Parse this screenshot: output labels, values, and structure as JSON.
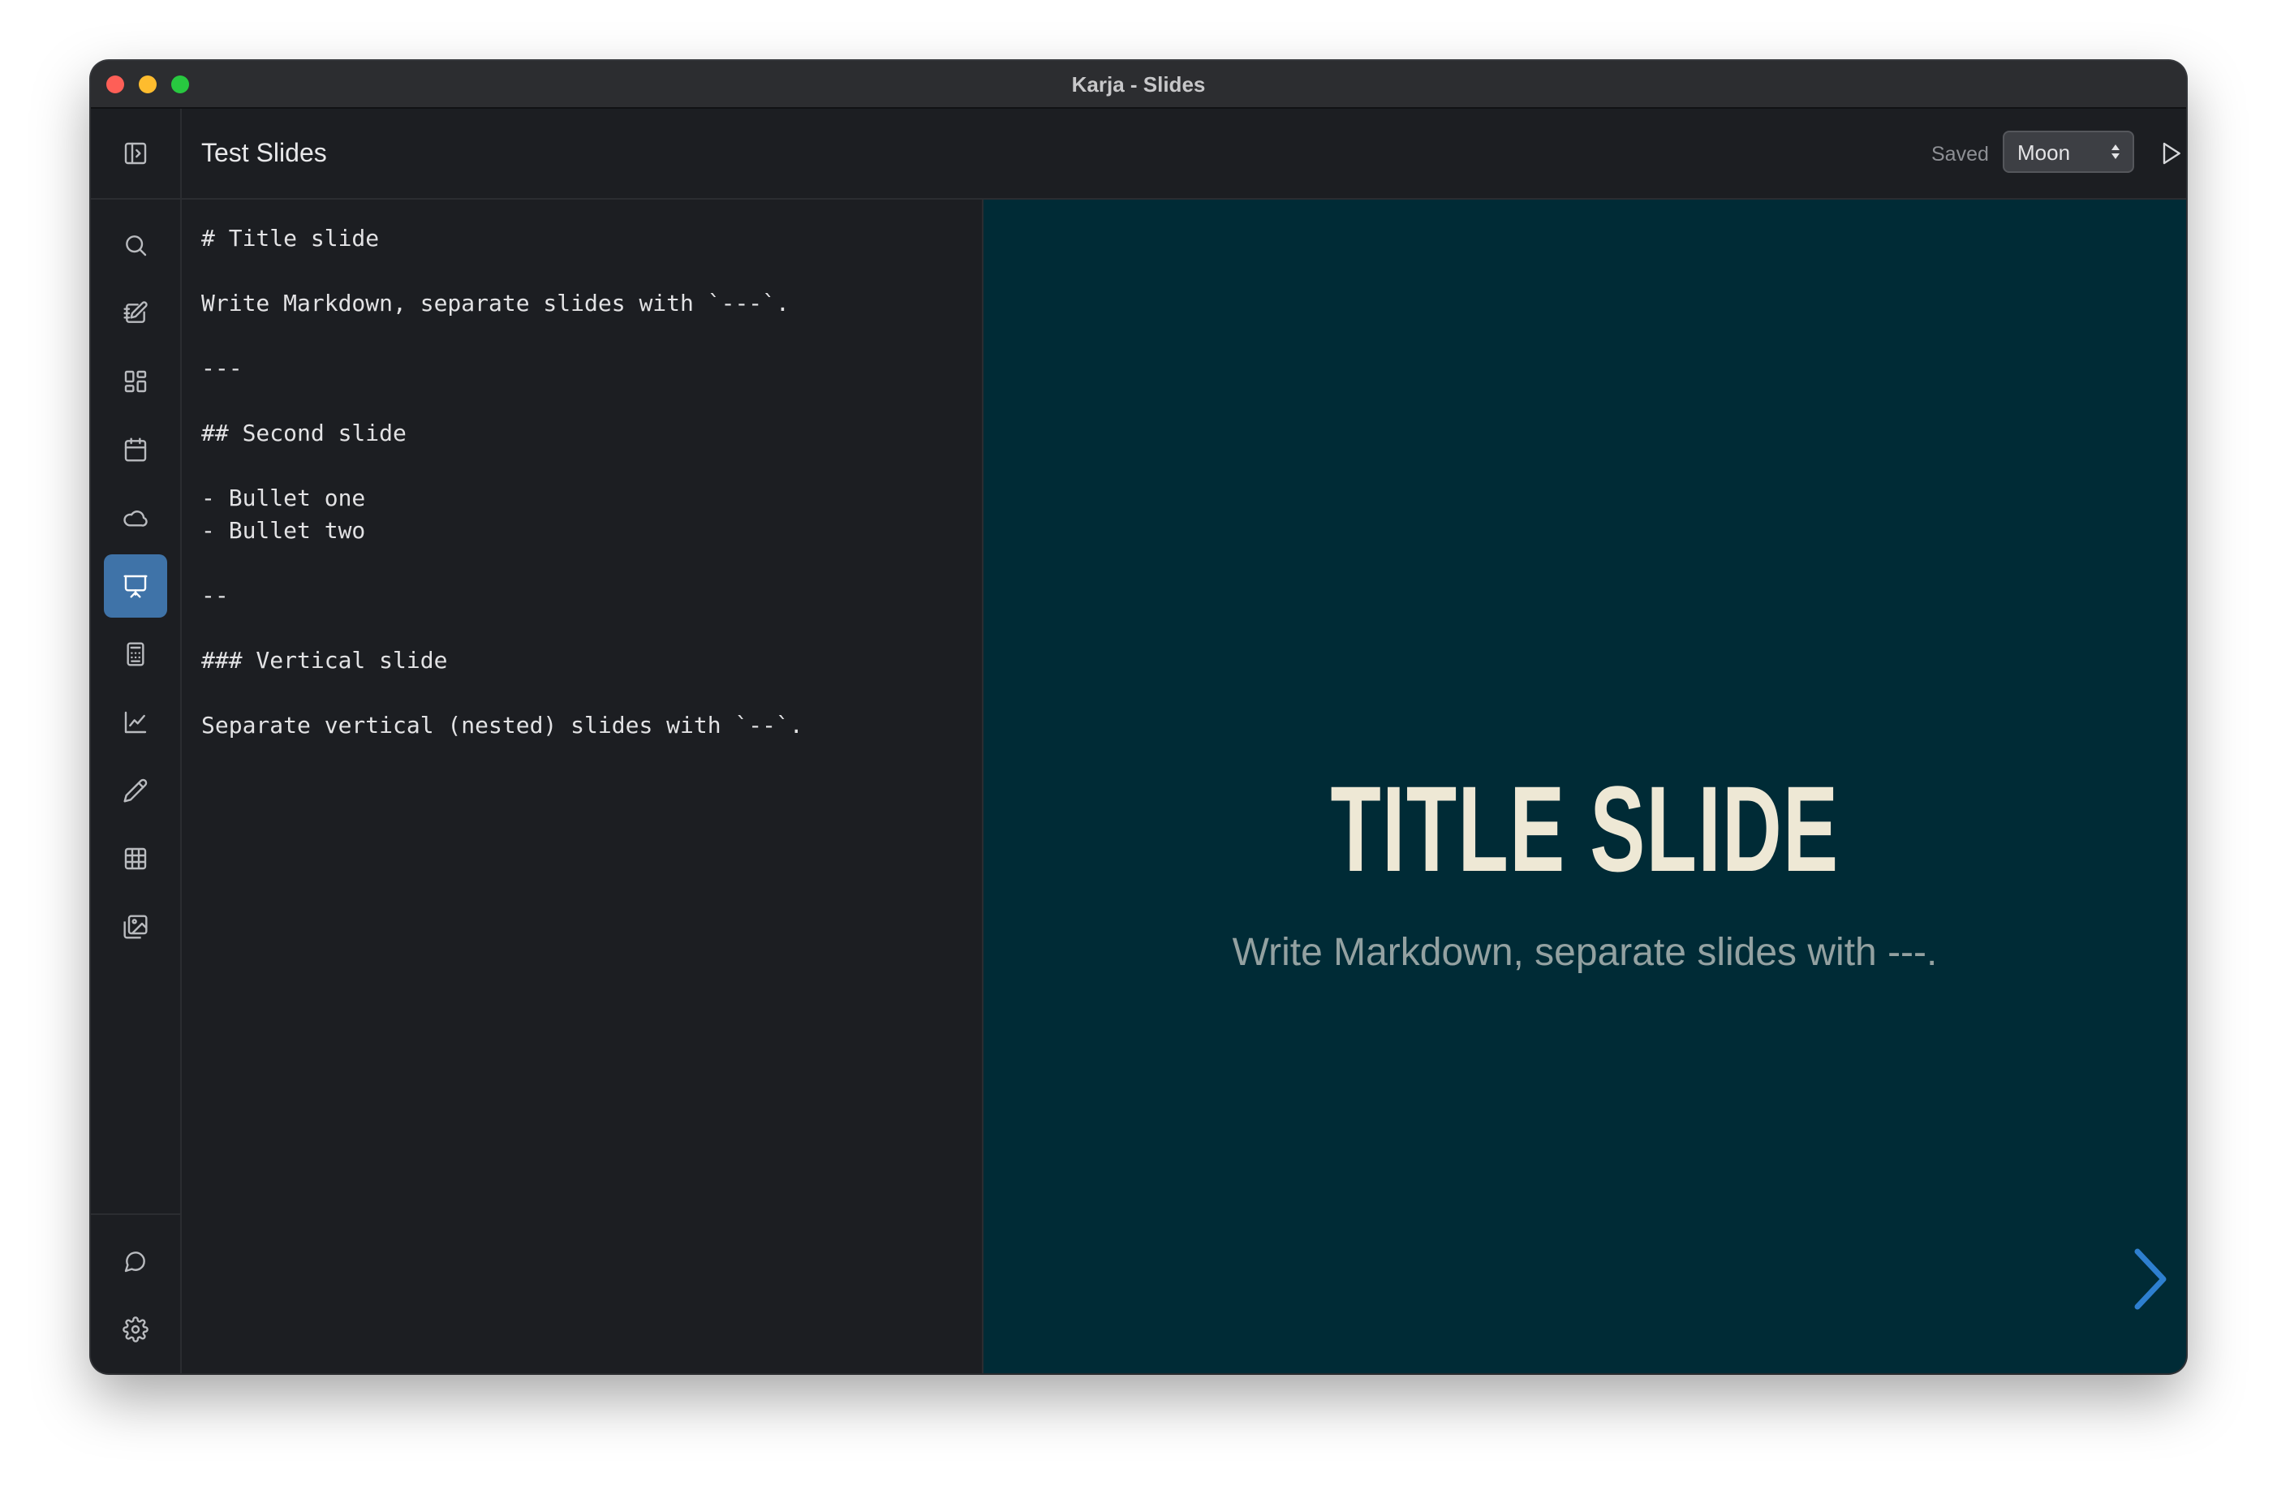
{
  "window": {
    "title": "Karja - Slides"
  },
  "sidebar": {
    "top_icon": "sidebar-toggle-icon",
    "items": [
      {
        "icon": "search-icon"
      },
      {
        "icon": "notes-icon"
      },
      {
        "icon": "dashboard-icon"
      },
      {
        "icon": "calendar-icon"
      },
      {
        "icon": "cloud-icon"
      },
      {
        "icon": "slides-icon",
        "active": true
      },
      {
        "icon": "calculator-icon"
      },
      {
        "icon": "chart-icon"
      },
      {
        "icon": "pencil-icon"
      },
      {
        "icon": "table-icon"
      },
      {
        "icon": "images-icon"
      }
    ],
    "bottom": [
      {
        "icon": "chat-icon"
      },
      {
        "icon": "settings-icon"
      }
    ]
  },
  "header": {
    "doc_title": "Test Slides",
    "status": "Saved",
    "theme": "Moon",
    "play_icon": "play-icon",
    "panel_icon": "panel-toggle-icon"
  },
  "editor": {
    "content": "# Title slide\n\nWrite Markdown, separate slides with `---`.\n\n---\n\n## Second slide\n\n- Bullet one\n- Bullet two\n\n--\n\n### Vertical slide\n\nSeparate vertical (nested) slides with `--`."
  },
  "preview": {
    "title": "TITLE SLIDE",
    "subtitle": "Write Markdown, separate slides with ---.",
    "background": "#002b36",
    "title_color": "#eee8d5",
    "text_color": "#93a1a1",
    "next_icon": "chevron-right-icon"
  },
  "colors": {
    "accent": "#3f73a8",
    "arrow": "#2e7fcf"
  }
}
